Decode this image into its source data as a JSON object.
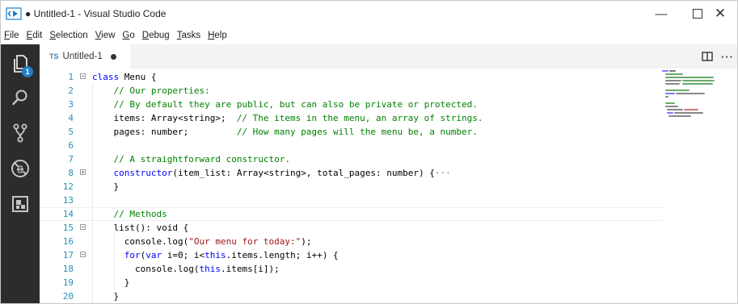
{
  "window": {
    "title": "● Untitled-1 - Visual Studio Code",
    "minimize": "—",
    "close": "✕"
  },
  "menu": [
    {
      "mnemonic": "F",
      "rest": "ile"
    },
    {
      "mnemonic": "E",
      "rest": "dit"
    },
    {
      "mnemonic": "S",
      "rest": "election"
    },
    {
      "mnemonic": "V",
      "rest": "iew"
    },
    {
      "mnemonic": "G",
      "rest": "o"
    },
    {
      "mnemonic": "D",
      "rest": "ebug"
    },
    {
      "mnemonic": "T",
      "rest": "asks"
    },
    {
      "mnemonic": "H",
      "rest": "elp"
    }
  ],
  "activity": {
    "explorer_badge": "1"
  },
  "tab": {
    "badge": "TS",
    "label": "Untitled-1",
    "more": "···"
  },
  "colors": {
    "keyword": "#0000ff",
    "comment": "#008000",
    "string": "#a31515",
    "line_number": "#2b91af",
    "activity_bar": "#2c2c2c"
  },
  "editor": {
    "lines": [
      {
        "n": "1",
        "fold": "minus",
        "tokens": [
          [
            "keyword",
            "class"
          ],
          [
            "text",
            " Menu {"
          ]
        ]
      },
      {
        "n": "2",
        "fold": "",
        "tokens": [
          [
            "text",
            "    "
          ],
          [
            "comment",
            "// Our properties:"
          ]
        ]
      },
      {
        "n": "3",
        "fold": "",
        "tokens": [
          [
            "text",
            "    "
          ],
          [
            "comment",
            "// By default they are public, but can also be private or protected."
          ]
        ]
      },
      {
        "n": "4",
        "fold": "",
        "tokens": [
          [
            "text",
            "    items: Array<string>;  "
          ],
          [
            "comment",
            "// The items in the menu, an array of strings."
          ]
        ]
      },
      {
        "n": "5",
        "fold": "",
        "tokens": [
          [
            "text",
            "    pages: number;         "
          ],
          [
            "comment",
            "// How many pages will the menu be, a number."
          ]
        ]
      },
      {
        "n": "6",
        "fold": "",
        "tokens": []
      },
      {
        "n": "7",
        "fold": "",
        "tokens": [
          [
            "text",
            "    "
          ],
          [
            "comment",
            "// A straightforward constructor."
          ]
        ]
      },
      {
        "n": "8",
        "fold": "plus",
        "tokens": [
          [
            "text",
            "    "
          ],
          [
            "keyword",
            "constructor"
          ],
          [
            "text",
            "(item_list: Array<string>, total_pages: number) {"
          ],
          [
            "fold",
            "···"
          ]
        ]
      },
      {
        "n": "12",
        "fold": "",
        "tokens": [
          [
            "text",
            "    }"
          ]
        ]
      },
      {
        "n": "13",
        "fold": "",
        "tokens": []
      },
      {
        "n": "14",
        "fold": "",
        "current": true,
        "tokens": [
          [
            "text",
            "    "
          ],
          [
            "comment",
            "// Methods"
          ]
        ]
      },
      {
        "n": "15",
        "fold": "minus",
        "tokens": [
          [
            "text",
            "    list(): void {"
          ]
        ]
      },
      {
        "n": "16",
        "fold": "",
        "tokens": [
          [
            "text",
            "      console.log("
          ],
          [
            "string",
            "\"Our menu for today:\""
          ],
          [
            "text",
            ");"
          ]
        ]
      },
      {
        "n": "17",
        "fold": "minus",
        "tokens": [
          [
            "text",
            "      "
          ],
          [
            "keyword",
            "for"
          ],
          [
            "text",
            "("
          ],
          [
            "keyword",
            "var"
          ],
          [
            "text",
            " i=0; i<"
          ],
          [
            "keyword",
            "this"
          ],
          [
            "text",
            ".items.length; i++) {"
          ]
        ]
      },
      {
        "n": "18",
        "fold": "",
        "tokens": [
          [
            "text",
            "        console.log("
          ],
          [
            "keyword",
            "this"
          ],
          [
            "text",
            ".items[i]);"
          ]
        ]
      },
      {
        "n": "19",
        "fold": "",
        "tokens": [
          [
            "text",
            "      }"
          ]
        ]
      },
      {
        "n": "20",
        "fold": "",
        "tokens": [
          [
            "text",
            "    }"
          ]
        ]
      }
    ]
  }
}
